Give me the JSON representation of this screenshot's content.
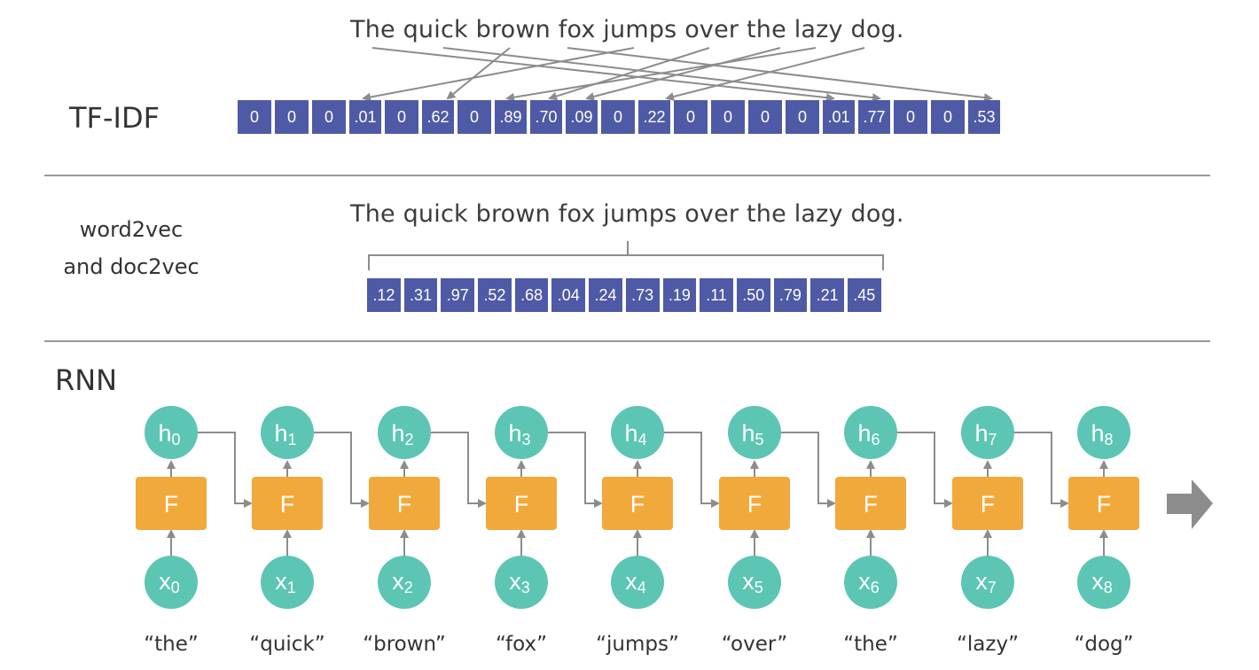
{
  "tfidf": {
    "label": "TF-IDF",
    "sentence": "The quick brown fox jumps over the lazy dog.",
    "values": [
      "0",
      "0",
      "0",
      ".01",
      "0",
      ".62",
      "0",
      ".89",
      ".70",
      ".09",
      "0",
      ".22",
      "0",
      "0",
      "0",
      "0",
      ".01",
      ".77",
      "0",
      "0",
      ".53"
    ]
  },
  "doc2vec": {
    "label_line1": "word2vec",
    "label_line2": "and doc2vec",
    "sentence": "The quick brown fox jumps over the lazy dog.",
    "values": [
      ".12",
      ".31",
      ".97",
      ".52",
      ".68",
      ".04",
      ".24",
      ".73",
      ".19",
      ".11",
      ".50",
      ".79",
      ".21",
      ".45"
    ]
  },
  "rnn": {
    "label": "RNN",
    "function_label": "F",
    "hidden_prefix": "h",
    "input_prefix": "x",
    "indices": [
      "0",
      "1",
      "2",
      "3",
      "4",
      "5",
      "6",
      "7",
      "8"
    ],
    "words": [
      "“the”",
      "“quick”",
      "“brown”",
      "“fox”",
      "“jumps”",
      "“over”",
      "“the”",
      "“lazy”",
      "“dog”"
    ]
  },
  "colors": {
    "vector_cell": "#4f5aa6",
    "function_box": "#f2a93b",
    "node_circle": "#5cc5b4",
    "connector": "#8c8c8c"
  }
}
